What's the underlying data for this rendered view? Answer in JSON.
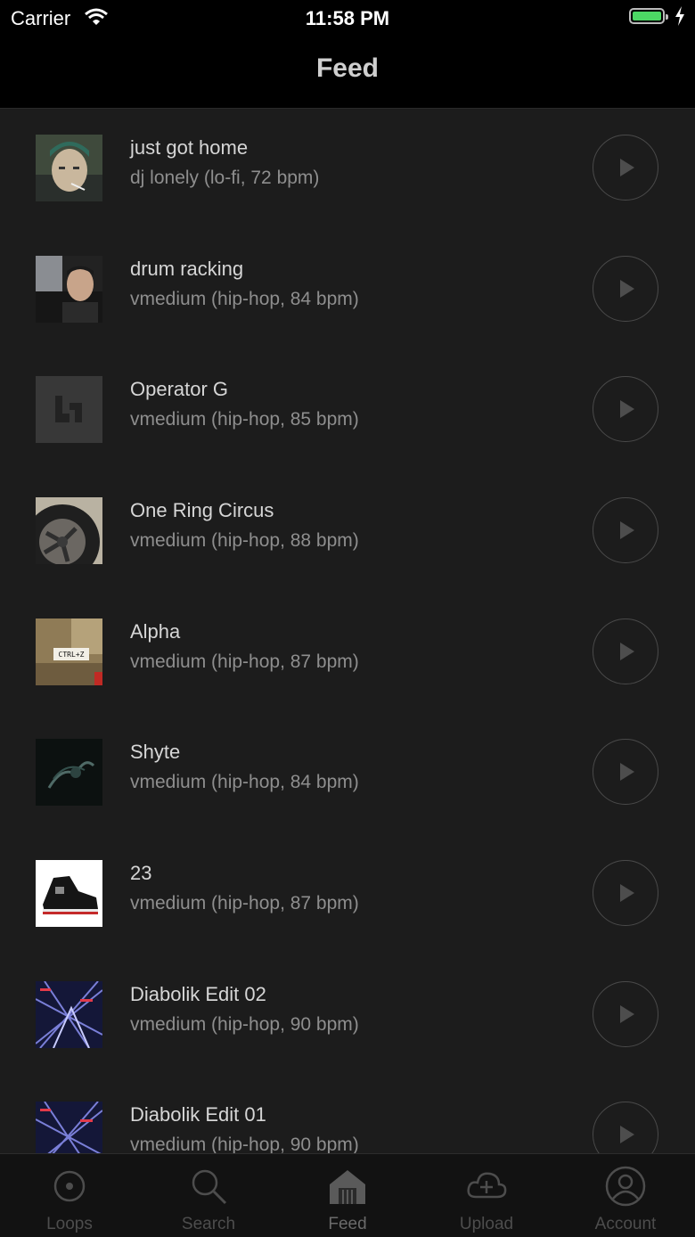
{
  "status_bar": {
    "carrier": "Carrier",
    "time": "11:58 PM"
  },
  "nav": {
    "title": "Feed"
  },
  "feed": [
    {
      "title": "just got home",
      "subtitle": "dj lonely (lo-fi, 72 bpm)"
    },
    {
      "title": "drum racking",
      "subtitle": "vmedium (hip-hop, 84 bpm)"
    },
    {
      "title": "Operator G",
      "subtitle": "vmedium (hip-hop, 85 bpm)"
    },
    {
      "title": "One Ring Circus",
      "subtitle": "vmedium (hip-hop, 88 bpm)"
    },
    {
      "title": "Alpha",
      "subtitle": "vmedium (hip-hop, 87 bpm)",
      "artwork_text": "CTRL+Z"
    },
    {
      "title": "Shyte",
      "subtitle": "vmedium (hip-hop, 84 bpm)"
    },
    {
      "title": "23",
      "subtitle": "vmedium (hip-hop, 87 bpm)"
    },
    {
      "title": "Diabolik Edit 02",
      "subtitle": "vmedium (hip-hop, 90 bpm)"
    },
    {
      "title": "Diabolik Edit 01",
      "subtitle": "vmedium (hip-hop, 90 bpm)"
    }
  ],
  "tabs": [
    {
      "label": "Loops",
      "icon": "loops-icon"
    },
    {
      "label": "Search",
      "icon": "search-icon"
    },
    {
      "label": "Feed",
      "icon": "feed-icon",
      "active": true
    },
    {
      "label": "Upload",
      "icon": "upload-icon"
    },
    {
      "label": "Account",
      "icon": "account-icon"
    }
  ],
  "colors": {
    "background": "#1c1c1c",
    "bar": "#000000",
    "battery": "#4cd964"
  }
}
